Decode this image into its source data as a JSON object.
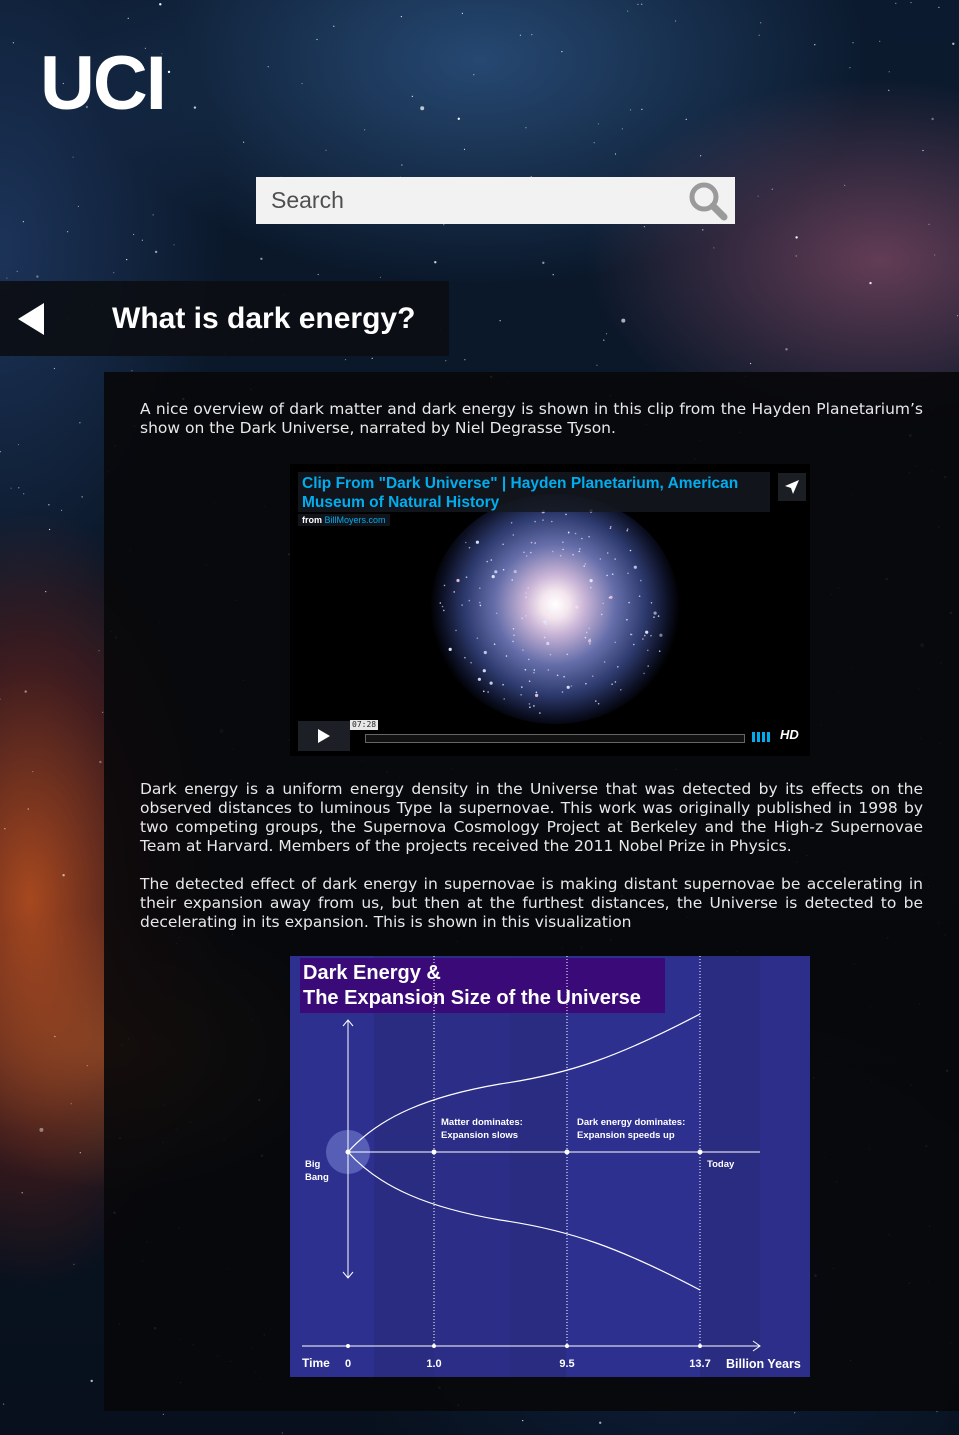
{
  "logo": "UCI",
  "search": {
    "placeholder": "Search"
  },
  "header": {
    "title": "What is dark energy?"
  },
  "content": {
    "intro": "A nice overview of dark matter and dark energy is shown in this clip from the Hayden Planetarium’s show on the Dark Universe, narrated by Niel Degrasse Tyson.",
    "paragraph_1": "Dark energy is a uniform energy density in the Universe that was detected by its effects on the observed distances to luminous Type Ia supernovae. This work was originally published in 1998 by two competing groups, the Supernova Cosmology Project at Berkeley and the High-z Supernovae Team at Harvard. Members of the projects received the 2011 Nobel Prize in Physics.",
    "paragraph_2": "The detected effect of dark energy in supernovae is making distant supernovae be accelerating in their expansion away from us, but then at the furthest distances, the Universe is detected to be decelerating in its expansion. This is shown in this visualization"
  },
  "video": {
    "title": "Clip From \"Dark Universe\" | Hayden Planetarium, American Museum of Natural History",
    "from_label": "from",
    "from_source": "BillMoyers.com",
    "timecode": "07:28",
    "hd_label": "HD",
    "progress": 0.0,
    "icons": {
      "share": "paper-plane-icon",
      "play": "play-icon",
      "volume": "volume-bars-icon"
    }
  },
  "figure": {
    "title_line1": "Dark Energy &",
    "title_line2": "The Expansion Size of the Universe",
    "annotation_matter": [
      "Matter dominates:",
      "Expansion slows"
    ],
    "annotation_dark": [
      "Dark energy dominates:",
      "Expansion speeds up"
    ],
    "label_big_bang": [
      "Big",
      "Bang"
    ],
    "label_today": "Today",
    "axis_label_time": "Time",
    "axis_unit": "Billion Years",
    "ticks": [
      "0",
      "1.0",
      "9.5",
      "13.7"
    ]
  },
  "colors": {
    "accent": "#00adef",
    "panel": "#0b0b0d",
    "figure_bg": "#2a2c82",
    "figure_title_bg": "#3a0a78",
    "search_bg": "#f2f2f2"
  }
}
